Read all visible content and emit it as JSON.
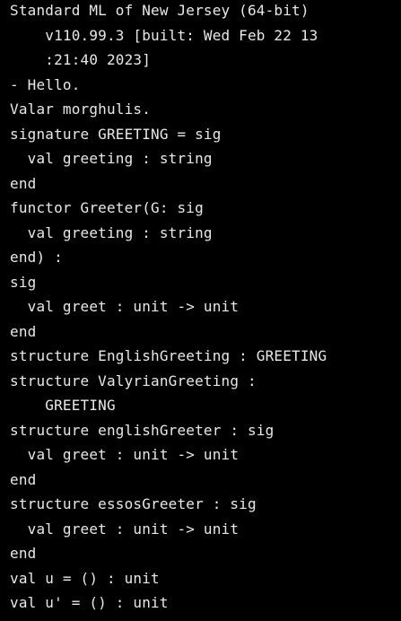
{
  "terminal": {
    "background": "#000000",
    "foreground": "#e8e8e8",
    "lines": [
      "Standard ML of New Jersey (64-bit)",
      "    v110.99.3 [built: Wed Feb 22 13",
      "    :21:40 2023]",
      "- Hello.",
      "Valar morghulis.",
      "signature GREETING = sig",
      "  val greeting : string",
      "end",
      "functor Greeter(G: sig",
      "  val greeting : string",
      "end) :",
      "sig",
      "  val greet : unit -> unit",
      "end",
      "structure EnglishGreeting : GREETING",
      "structure ValyrianGreeting :",
      "    GREETING",
      "structure englishGreeter : sig",
      "  val greet : unit -> unit",
      "end",
      "structure essosGreeter : sig",
      "  val greet : unit -> unit",
      "end",
      "val u = () : unit",
      "val u' = () : unit"
    ]
  }
}
